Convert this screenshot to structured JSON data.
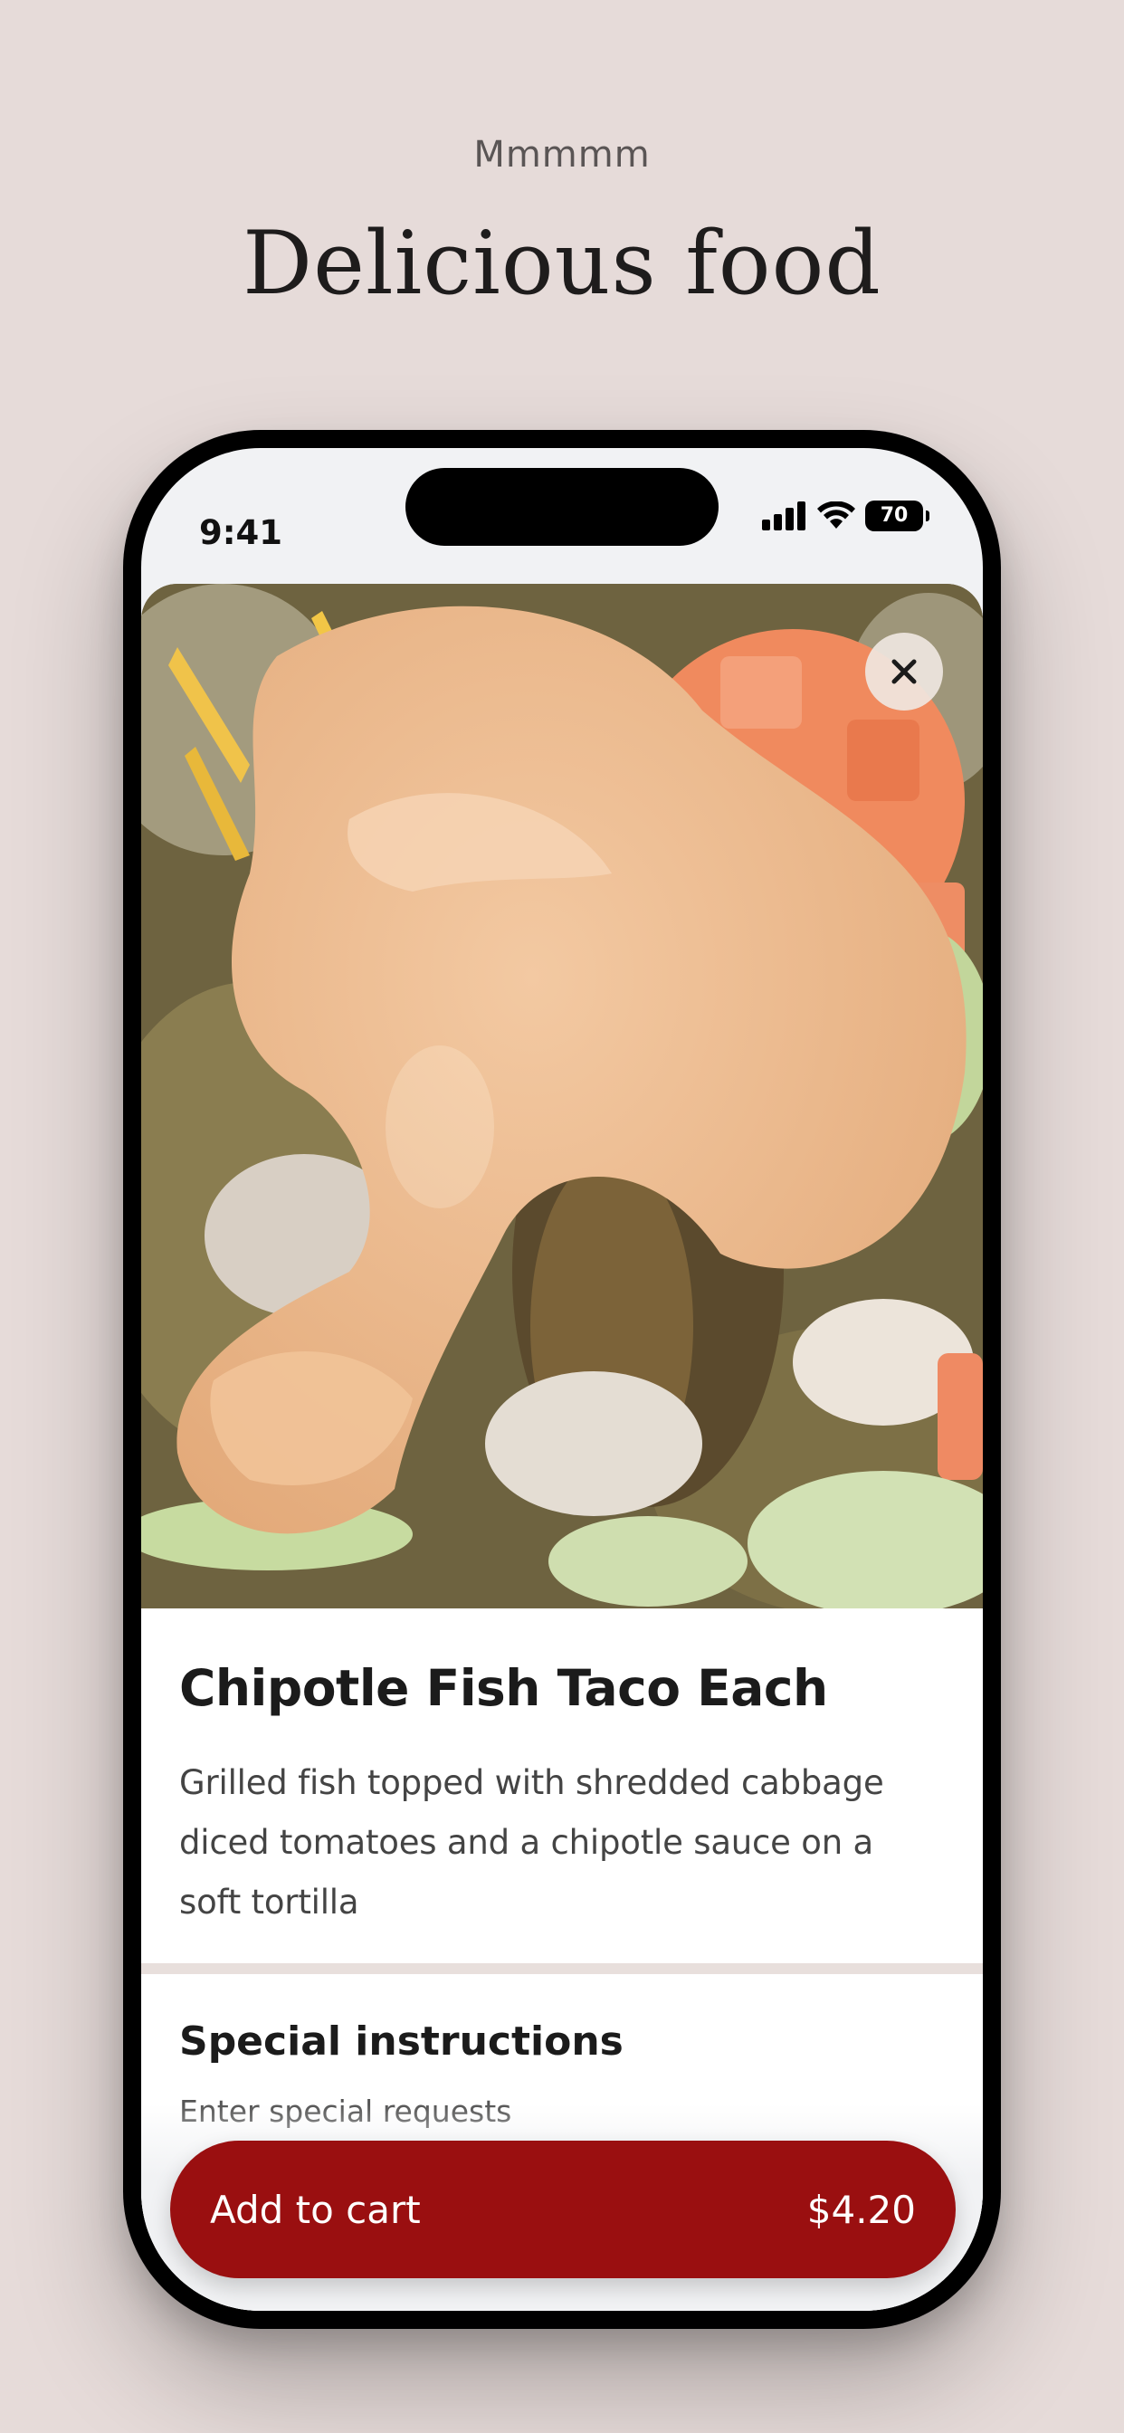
{
  "header": {
    "eyebrow": "Mmmmm",
    "title": "Delicious food"
  },
  "status_bar": {
    "time": "9:41",
    "battery": "70",
    "icons": [
      "cellular-signal-icon",
      "wifi-icon",
      "battery-icon"
    ]
  },
  "item": {
    "image_alt": "Chipotle Fish Taco photo",
    "title": "Chipotle Fish Taco Each",
    "description": "Grilled fish topped with shredded cabbage diced tomatoes and a chipotle sauce on a soft tortilla"
  },
  "special_instructions": {
    "title": "Special instructions",
    "placeholder": "Enter special requests"
  },
  "cart_button": {
    "label": "Add to cart",
    "price": "$4.20"
  },
  "colors": {
    "background": "#e6dbd9",
    "accent": "#9a0f10"
  }
}
